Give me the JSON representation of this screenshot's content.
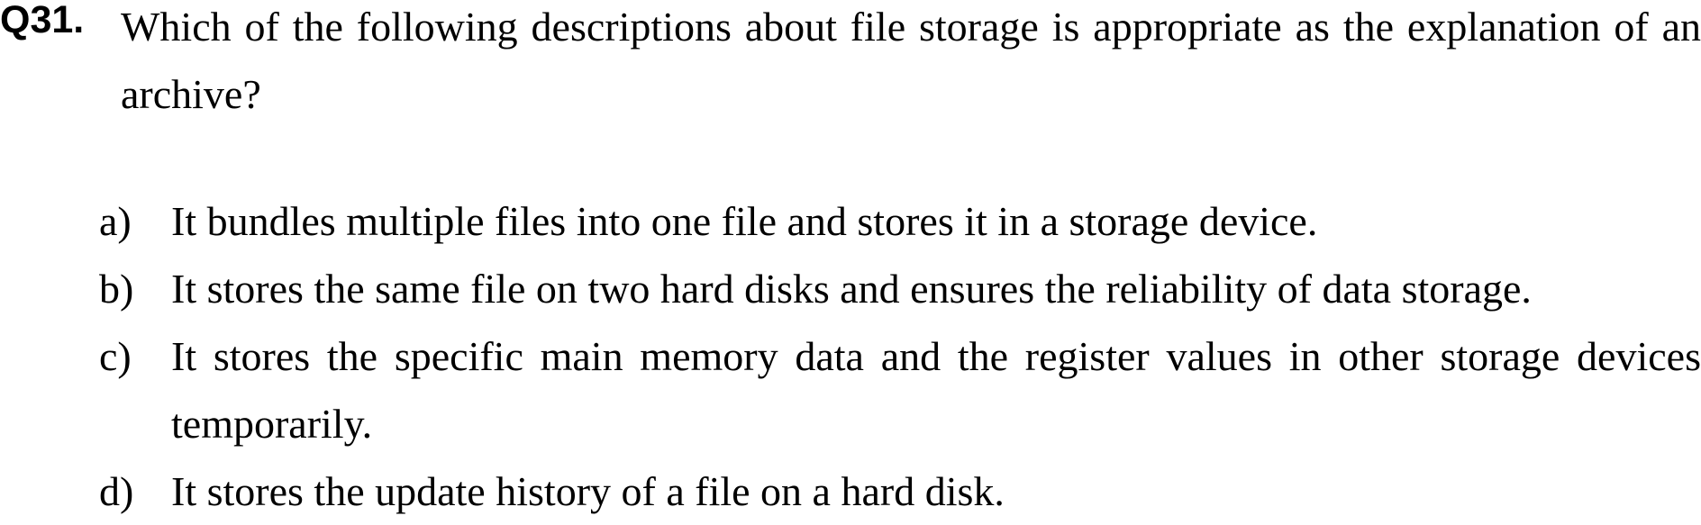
{
  "question": {
    "number": "Q31.",
    "stem": "Which of the following descriptions about file storage is appropriate as the explanation of an archive?"
  },
  "options": [
    {
      "letter": "a)",
      "text": "It bundles multiple files into one file and stores it in a storage device."
    },
    {
      "letter": "b)",
      "text": "It stores the same file on two hard disks and ensures the reliability of data storage."
    },
    {
      "letter": "c)",
      "text": "It stores the specific main memory data and the register values in other storage devices temporarily."
    },
    {
      "letter": "d)",
      "text": "It stores the update history of a file on a hard disk."
    }
  ]
}
